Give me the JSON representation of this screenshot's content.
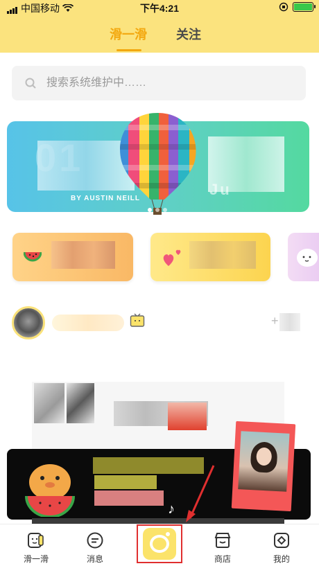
{
  "status_bar": {
    "carrier": "中国移动",
    "time": "下午4:21",
    "battery_level": 1.0,
    "battery_color": "#38c84a"
  },
  "header": {
    "tabs": [
      {
        "label": "滑一滑",
        "active": true
      },
      {
        "label": "关注",
        "active": false
      }
    ],
    "accent_color": "#f3a80f",
    "background": "#fbe37e"
  },
  "search": {
    "placeholder": "搜索系统维护中……",
    "icon": "search-icon"
  },
  "banner": {
    "credit": "BY AUSTIN NEILL",
    "partial_text": "Ju",
    "page_count": 3,
    "active_page": 1
  },
  "categories": [
    {
      "icon": "watermelon-icon",
      "color": "#f9b865"
    },
    {
      "icon": "hearts-icon",
      "color": "#fcd44f"
    },
    {
      "icon": "sticker-icon",
      "color": "#e8c8f2"
    }
  ],
  "promo": {
    "note_icon": "music-note-icon"
  },
  "tabbar": {
    "items": [
      {
        "label": "滑一滑",
        "icon": "swipe-icon"
      },
      {
        "label": "消息",
        "icon": "message-icon"
      },
      {
        "label": "",
        "icon": "camera-icon",
        "highlighted": true
      },
      {
        "label": "商店",
        "icon": "store-icon"
      },
      {
        "label": "我的",
        "icon": "profile-icon"
      }
    ],
    "highlight_color": "#e02f2f"
  }
}
